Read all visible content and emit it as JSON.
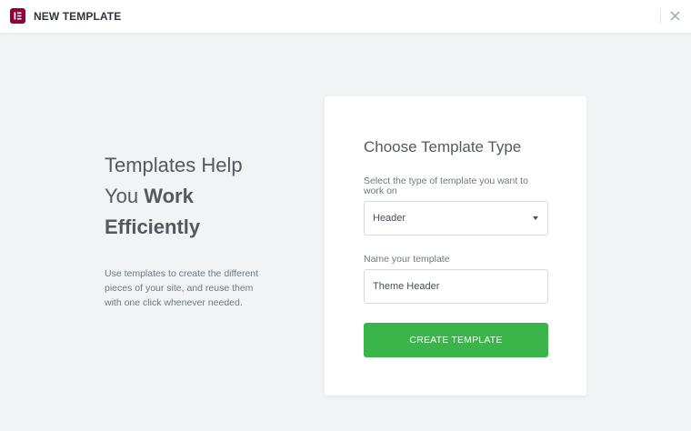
{
  "header": {
    "title": "NEW TEMPLATE",
    "logo_icon": "elementor-logo-icon",
    "close_icon": "close-icon"
  },
  "intro": {
    "title_line1": "Templates Help",
    "title_line2_plain": "You",
    "title_line2_bold": "Work",
    "title_line3_bold": "Efficiently",
    "description": "Use templates to create the different pieces of your site, and reuse them with one click whenever needed."
  },
  "form": {
    "title": "Choose Template Type",
    "type_label": "Select the type of template you want to work on",
    "type_value": "Header",
    "name_label": "Name your template",
    "name_value": "Theme Header",
    "submit_label": "CREATE TEMPLATE"
  },
  "colors": {
    "brand": "#92003b",
    "button": "#39b54a",
    "background": "#f1f3f5"
  }
}
